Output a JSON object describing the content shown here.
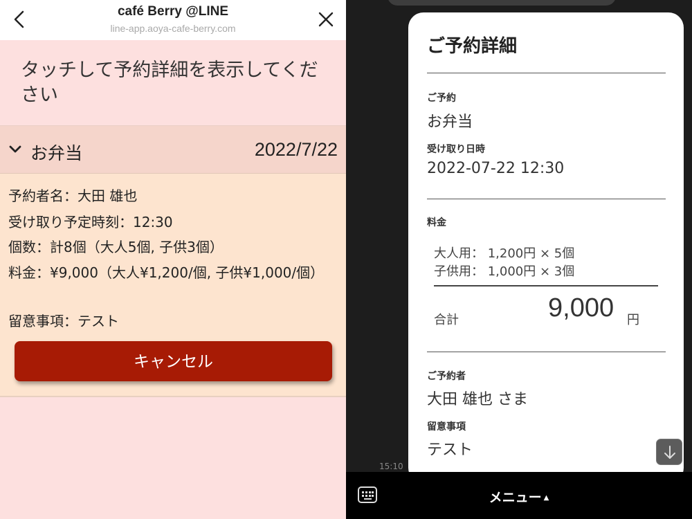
{
  "left": {
    "header": {
      "title": "café Berry @LINE",
      "url": "line-app.aoya-cafe-berry.com"
    },
    "instruction": "タッチして予約詳細を表示してください",
    "accordion": {
      "title": "お弁当",
      "date": "2022/7/22"
    },
    "details": {
      "name": "予約者名：大田 雄也",
      "pickup_time": "受け取り予定時刻：12:30",
      "count": "個数：計8個（大人5個, 子供3個）",
      "fee": "料金：¥9,000（大人¥1,200/個, 子供¥1,000/個）",
      "note": "留意事項：テスト"
    },
    "cancel_label": "キャンセル",
    "colors": {
      "background": "#fde0df",
      "accordion": "#f5d5cb",
      "details": "#fde4cf",
      "cancel": "#a71b05"
    }
  },
  "right": {
    "card": {
      "title": "ご予約詳細",
      "reservation_label": "ご予約",
      "reservation_value": "お弁当",
      "pickup_label": "受け取り日時",
      "pickup_value": "2022-07-22 12:30",
      "fee_label": "料金",
      "adult_line": "大人用： 1,200円 × 5個",
      "child_line": "子供用： 1,000円 × 3個",
      "total_label": "合計",
      "total_amount": "9,000",
      "total_unit": "円",
      "booker_label": "ご予約者",
      "booker_value": "大田 雄也 さま",
      "note_label": "留意事項",
      "note_value": "テスト"
    },
    "timestamp": "15:10",
    "menu_label": "メニュー",
    "menu_arrow": "▲",
    "icons": {
      "scroll": "arrow-down-icon",
      "keyboard": "keyboard-icon"
    },
    "colors": {
      "background": "#1d1d1d",
      "card": "#ffffff",
      "bar": "#000000"
    }
  }
}
